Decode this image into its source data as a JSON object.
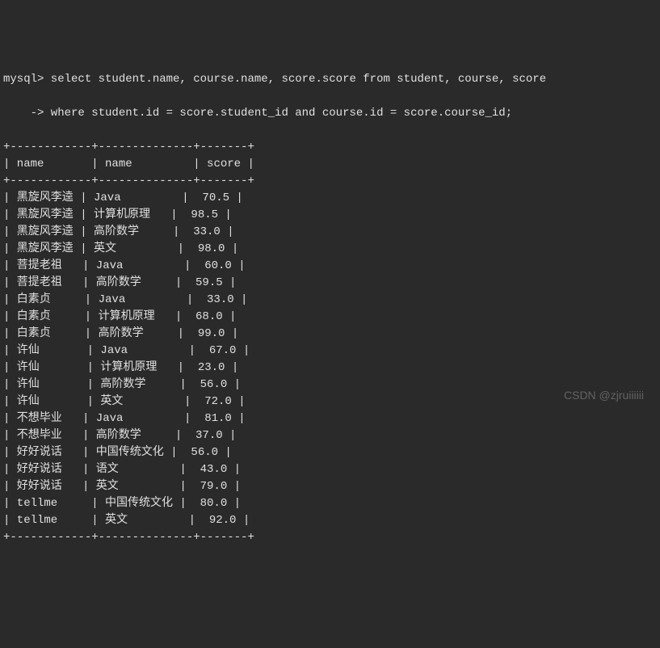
{
  "prompt": {
    "line1": "mysql> select student.name, course.name, score.score from student, course, score",
    "line2": "    -> where student.id = score.student_id and course.id = score.course_id;"
  },
  "table": {
    "headers": [
      "name",
      "name",
      "score"
    ],
    "rows": [
      [
        "黑旋风李逵",
        "Java",
        "70.5"
      ],
      [
        "黑旋风李逵",
        "计算机原理",
        "98.5"
      ],
      [
        "黑旋风李逵",
        "高阶数学",
        "33.0"
      ],
      [
        "黑旋风李逵",
        "英文",
        "98.0"
      ],
      [
        "菩提老祖",
        "Java",
        "60.0"
      ],
      [
        "菩提老祖",
        "高阶数学",
        "59.5"
      ],
      [
        "白素贞",
        "Java",
        "33.0"
      ],
      [
        "白素贞",
        "计算机原理",
        "68.0"
      ],
      [
        "白素贞",
        "高阶数学",
        "99.0"
      ],
      [
        "许仙",
        "Java",
        "67.0"
      ],
      [
        "许仙",
        "计算机原理",
        "23.0"
      ],
      [
        "许仙",
        "高阶数学",
        "56.0"
      ],
      [
        "许仙",
        "英文",
        "72.0"
      ],
      [
        "不想毕业",
        "Java",
        "81.0"
      ],
      [
        "不想毕业",
        "高阶数学",
        "37.0"
      ],
      [
        "好好说话",
        "中国传统文化",
        "56.0"
      ],
      [
        "好好说话",
        "语文",
        "43.0"
      ],
      [
        "好好说话",
        "英文",
        "79.0"
      ],
      [
        "tellme",
        "中国传统文化",
        "80.0"
      ],
      [
        "tellme",
        "英文",
        "92.0"
      ]
    ]
  },
  "watermark": "CSDN @zjruiiiiii"
}
